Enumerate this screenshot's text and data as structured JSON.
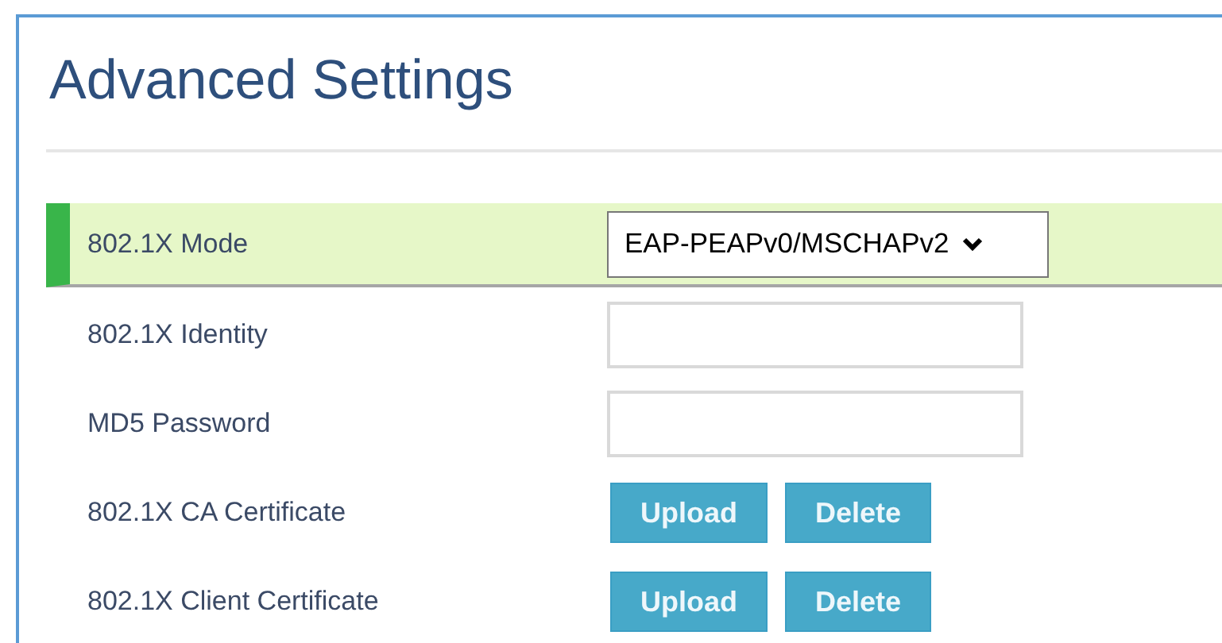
{
  "title": "Advanced Settings",
  "rows": [
    {
      "label": "802.1X Mode",
      "kind": "select",
      "selected": true,
      "value": "EAP-PEAPv0/MSCHAPv2"
    },
    {
      "label": "802.1X Identity",
      "kind": "input",
      "selected": false
    },
    {
      "label": "MD5 Password",
      "kind": "input",
      "selected": false
    },
    {
      "label": "802.1X CA Certificate",
      "kind": "buttons",
      "selected": false,
      "buttons": [
        "Upload",
        "Delete"
      ]
    },
    {
      "label": "802.1X Client Certificate",
      "kind": "buttons",
      "selected": false,
      "buttons": [
        "Upload",
        "Delete"
      ]
    }
  ]
}
